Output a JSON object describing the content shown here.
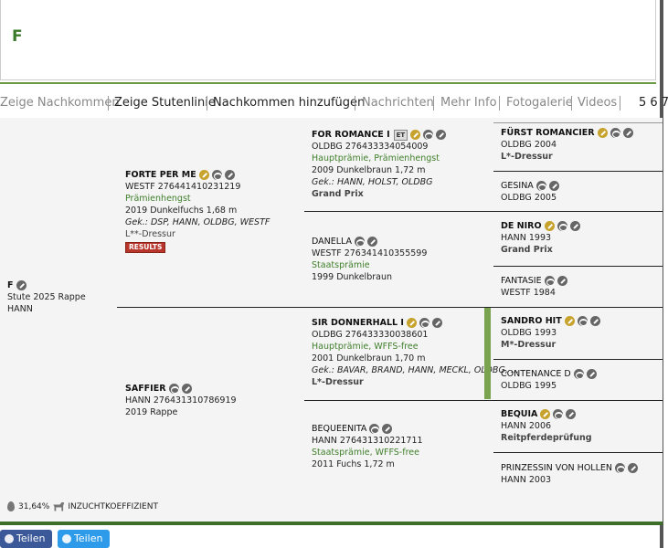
{
  "header": {
    "title": "F"
  },
  "tabs": [
    {
      "label": "Zeige Nachkommen",
      "style": "gray"
    },
    {
      "label": "Zeige Stutenlinie",
      "style": "dark"
    },
    {
      "label": "Nachkommen hinzufügen",
      "style": "dark"
    },
    {
      "label": "Nachrichten",
      "style": "gray"
    },
    {
      "label": "Mehr Info",
      "style": "gray"
    },
    {
      "label": "Fotogalerie",
      "style": "gray"
    },
    {
      "label": "Videos",
      "style": "gray"
    },
    {
      "label": "5 6 7",
      "style": "dark"
    }
  ],
  "subject": {
    "name": "F",
    "line1": "Stute 2025 Rappe",
    "line2": "HANN"
  },
  "sire": {
    "name": "FORTE PER ME",
    "id": "WESTF 276441410231219",
    "award": "Prämienhengst",
    "details": "2019 Dunkelfuchs 1,68 m",
    "breeds": "Gek.: DSP, HANN, OLDBG, WESTF",
    "level": "L**-Dressur",
    "results": "RESULTS"
  },
  "dam": {
    "name": "SAFFIER",
    "id": "HANN 276431310786919",
    "details": "2019 Rappe"
  },
  "ss": {
    "name": "FOR ROMANCE I",
    "et": "ET",
    "id": "OLDBG 276433334054009",
    "award": "Hauptprämie, Prämienhengst",
    "details": "2009 Dunkelbraun 1,72 m",
    "breeds": "Gek.: HANN, HOLST, OLDBG",
    "level": "Grand Prix"
  },
  "sd": {
    "name": "DANELLA",
    "id": "WESTF 276341410355599",
    "award": "Staatsprämie",
    "details": "1999 Dunkelbraun"
  },
  "ds": {
    "name": "SIR DONNERHALL I",
    "id": "OLDBG 276433330038601",
    "award": "Hauptprämie, WFFS-free",
    "details": "2001 Dunkelbraun 1,70 m",
    "breeds": "Gek.: BAVAR, BRAND, HANN, MECKL, OLDBG, ...",
    "level": "L*-Dressur"
  },
  "dd": {
    "name": "BEQUEENITA",
    "id": "HANN 276431310221711",
    "award": "Staatsprämie, WFFS-free",
    "details": "2011 Fuchs 1,72 m"
  },
  "g4": [
    {
      "name": "FÜRST ROMANCIER",
      "id": "OLDBG 2004",
      "level": "L*-Dressur"
    },
    {
      "name": "GESINA",
      "id": "OLDBG 2005"
    },
    {
      "name": "DE NIRO",
      "id": "HANN 1993",
      "level": "Grand Prix"
    },
    {
      "name": "FANTASIE",
      "id": "WESTF 1984"
    },
    {
      "name": "SANDRO HIT",
      "id": "OLDBG 1993",
      "level": "M*-Dressur"
    },
    {
      "name": "CONTENANCE D",
      "id": "OLDBG 1995"
    },
    {
      "name": "BEQUIA",
      "id": "HANN 2006",
      "level": "Reitpferdeprüfung"
    },
    {
      "name": "PRINZESSIN VON HOLLEN",
      "id": "HANN 2003"
    }
  ],
  "coi": {
    "value": "31,64%",
    "label": "INZUCHTKOEFFIZIENT"
  },
  "share": {
    "facebook": "Teilen",
    "twitter": "Teilen"
  },
  "icons": [
    "pencil-icon",
    "group-icon",
    "drop-icon",
    "horse-icon"
  ],
  "colors": {
    "green": "#3f7f2a",
    "gold": "#c7a32d",
    "results": "#b7352a",
    "facebook": "#3b5998",
    "twitter": "#2d9bea"
  }
}
